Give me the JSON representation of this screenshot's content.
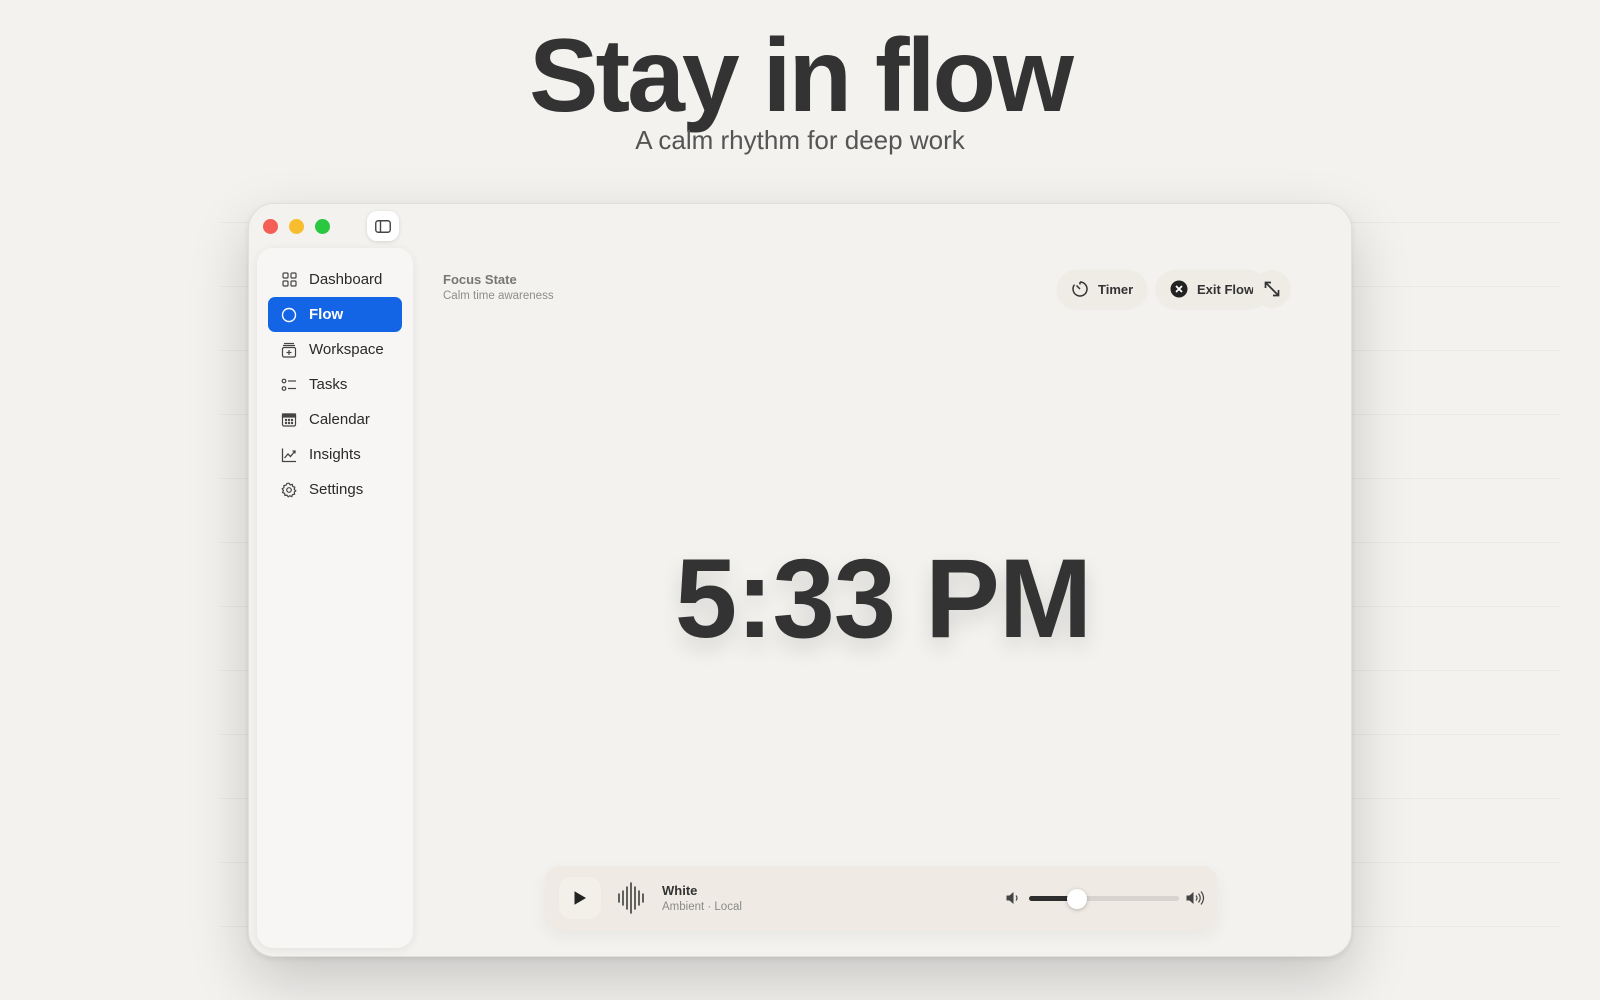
{
  "hero": {
    "title": "Stay in flow",
    "subtitle": "A calm rhythm for deep work"
  },
  "window": {
    "traffic_lights": [
      "close",
      "minimize",
      "zoom"
    ],
    "sidebar_toggle_icon": "sidebar-icon"
  },
  "sidebar": {
    "items": [
      {
        "label": "Dashboard",
        "icon": "grid-icon",
        "active": false
      },
      {
        "label": "Flow",
        "icon": "circle-icon",
        "active": true
      },
      {
        "label": "Workspace",
        "icon": "workspace-icon",
        "active": false
      },
      {
        "label": "Tasks",
        "icon": "checklist-icon",
        "active": false
      },
      {
        "label": "Calendar",
        "icon": "calendar-icon",
        "active": false
      },
      {
        "label": "Insights",
        "icon": "chart-icon",
        "active": false
      },
      {
        "label": "Settings",
        "icon": "gear-icon",
        "active": false
      }
    ]
  },
  "header": {
    "title": "Focus State",
    "subtitle": "Calm time awareness",
    "timer_label": "Timer",
    "exit_label": "Exit Flow"
  },
  "clock": {
    "time": "5:33 PM"
  },
  "player": {
    "track": "White",
    "meta": "Ambient · Local",
    "volume": 0.32
  },
  "colors": {
    "accent": "#1464e6",
    "background": "#f3f2ef",
    "close": "#f35e57",
    "minimize": "#f7bd2e",
    "zoom": "#2ac740"
  }
}
